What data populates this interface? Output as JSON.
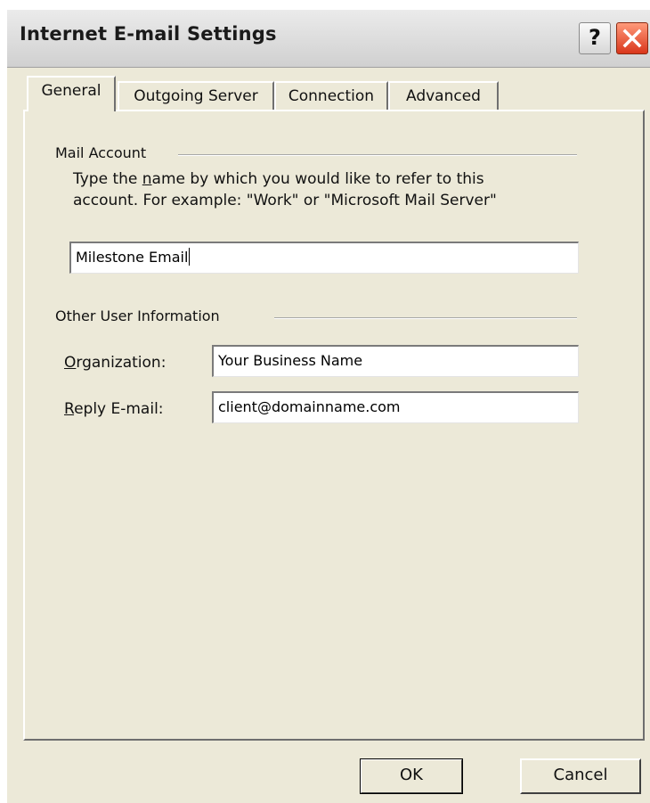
{
  "window": {
    "title": "Internet E-mail Settings",
    "help_label": "?",
    "close_icon": "close-icon"
  },
  "tabs": [
    {
      "label": "General",
      "active": true
    },
    {
      "label": "Outgoing Server",
      "active": false
    },
    {
      "label": "Connection",
      "active": false
    },
    {
      "label": "Advanced",
      "active": false
    }
  ],
  "mail_account": {
    "group_label": "Mail Account",
    "desc_pre": "Type the ",
    "desc_underlined": "n",
    "desc_post": "ame by which you would like to refer to this",
    "desc_line2": "account.  For example: \"Work\" or \"Microsoft Mail Server\"",
    "account_name_value": "Milestone Email"
  },
  "other_user": {
    "group_label": "Other User Information",
    "organization_label_u": "O",
    "organization_label_rest": "rganization:",
    "organization_value": "Your Business Name",
    "reply_label_u": "R",
    "reply_label_rest": "eply E-mail:",
    "reply_value": "client@domainname.com"
  },
  "buttons": {
    "ok_label": "OK",
    "cancel_label": "Cancel"
  },
  "colors": {
    "dialog_bg": "#ece9d8",
    "close_button": "#d9361b",
    "red_mark": "#ff0000"
  }
}
